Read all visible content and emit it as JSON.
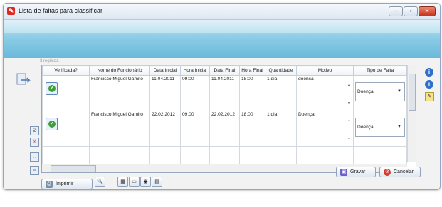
{
  "window": {
    "title": "Lista de faltas para classificar",
    "controls": {
      "minimize": "–",
      "maximize": "▫",
      "close": "✕"
    }
  },
  "records_text": "3 registos.",
  "grid": {
    "columns": [
      "Verificada?",
      "Nome do Funcionário",
      "Data Inicial",
      "Hora Inicial",
      "Data Final",
      "Hora Final",
      "Quantidade",
      "Motivo",
      "Tipo de Falta"
    ],
    "rows": [
      {
        "verificada": true,
        "nome": "Francisco Miguel Gamito",
        "data_inicial": "11.04.2011",
        "hora_inicial": "09:00",
        "data_final": "11.04.2011",
        "hora_final": "18:00",
        "quantidade": "1 dia",
        "motivo": "doença",
        "tipo_falta": "Doença"
      },
      {
        "verificada": true,
        "nome": "Francisco Miguel Gamito",
        "data_inicial": "22.02.2012",
        "hora_inicial": "09:00",
        "data_final": "22.02.2012",
        "hora_final": "18:00",
        "quantidade": "1 dia",
        "motivo": "Doença",
        "tipo_falta": "Doença"
      }
    ]
  },
  "buttons": {
    "imprimir": "Imprimir",
    "gravar": "Gravar",
    "cancelar": "Cancelar"
  },
  "icons": {
    "app": "form-icon",
    "check": "check-icon",
    "info": "info-icon",
    "export": "export-icon"
  },
  "colors": {
    "banner": "#8dcde6",
    "close": "#c9331c",
    "check": "#3ea03c",
    "info": "#2f6fc7"
  }
}
